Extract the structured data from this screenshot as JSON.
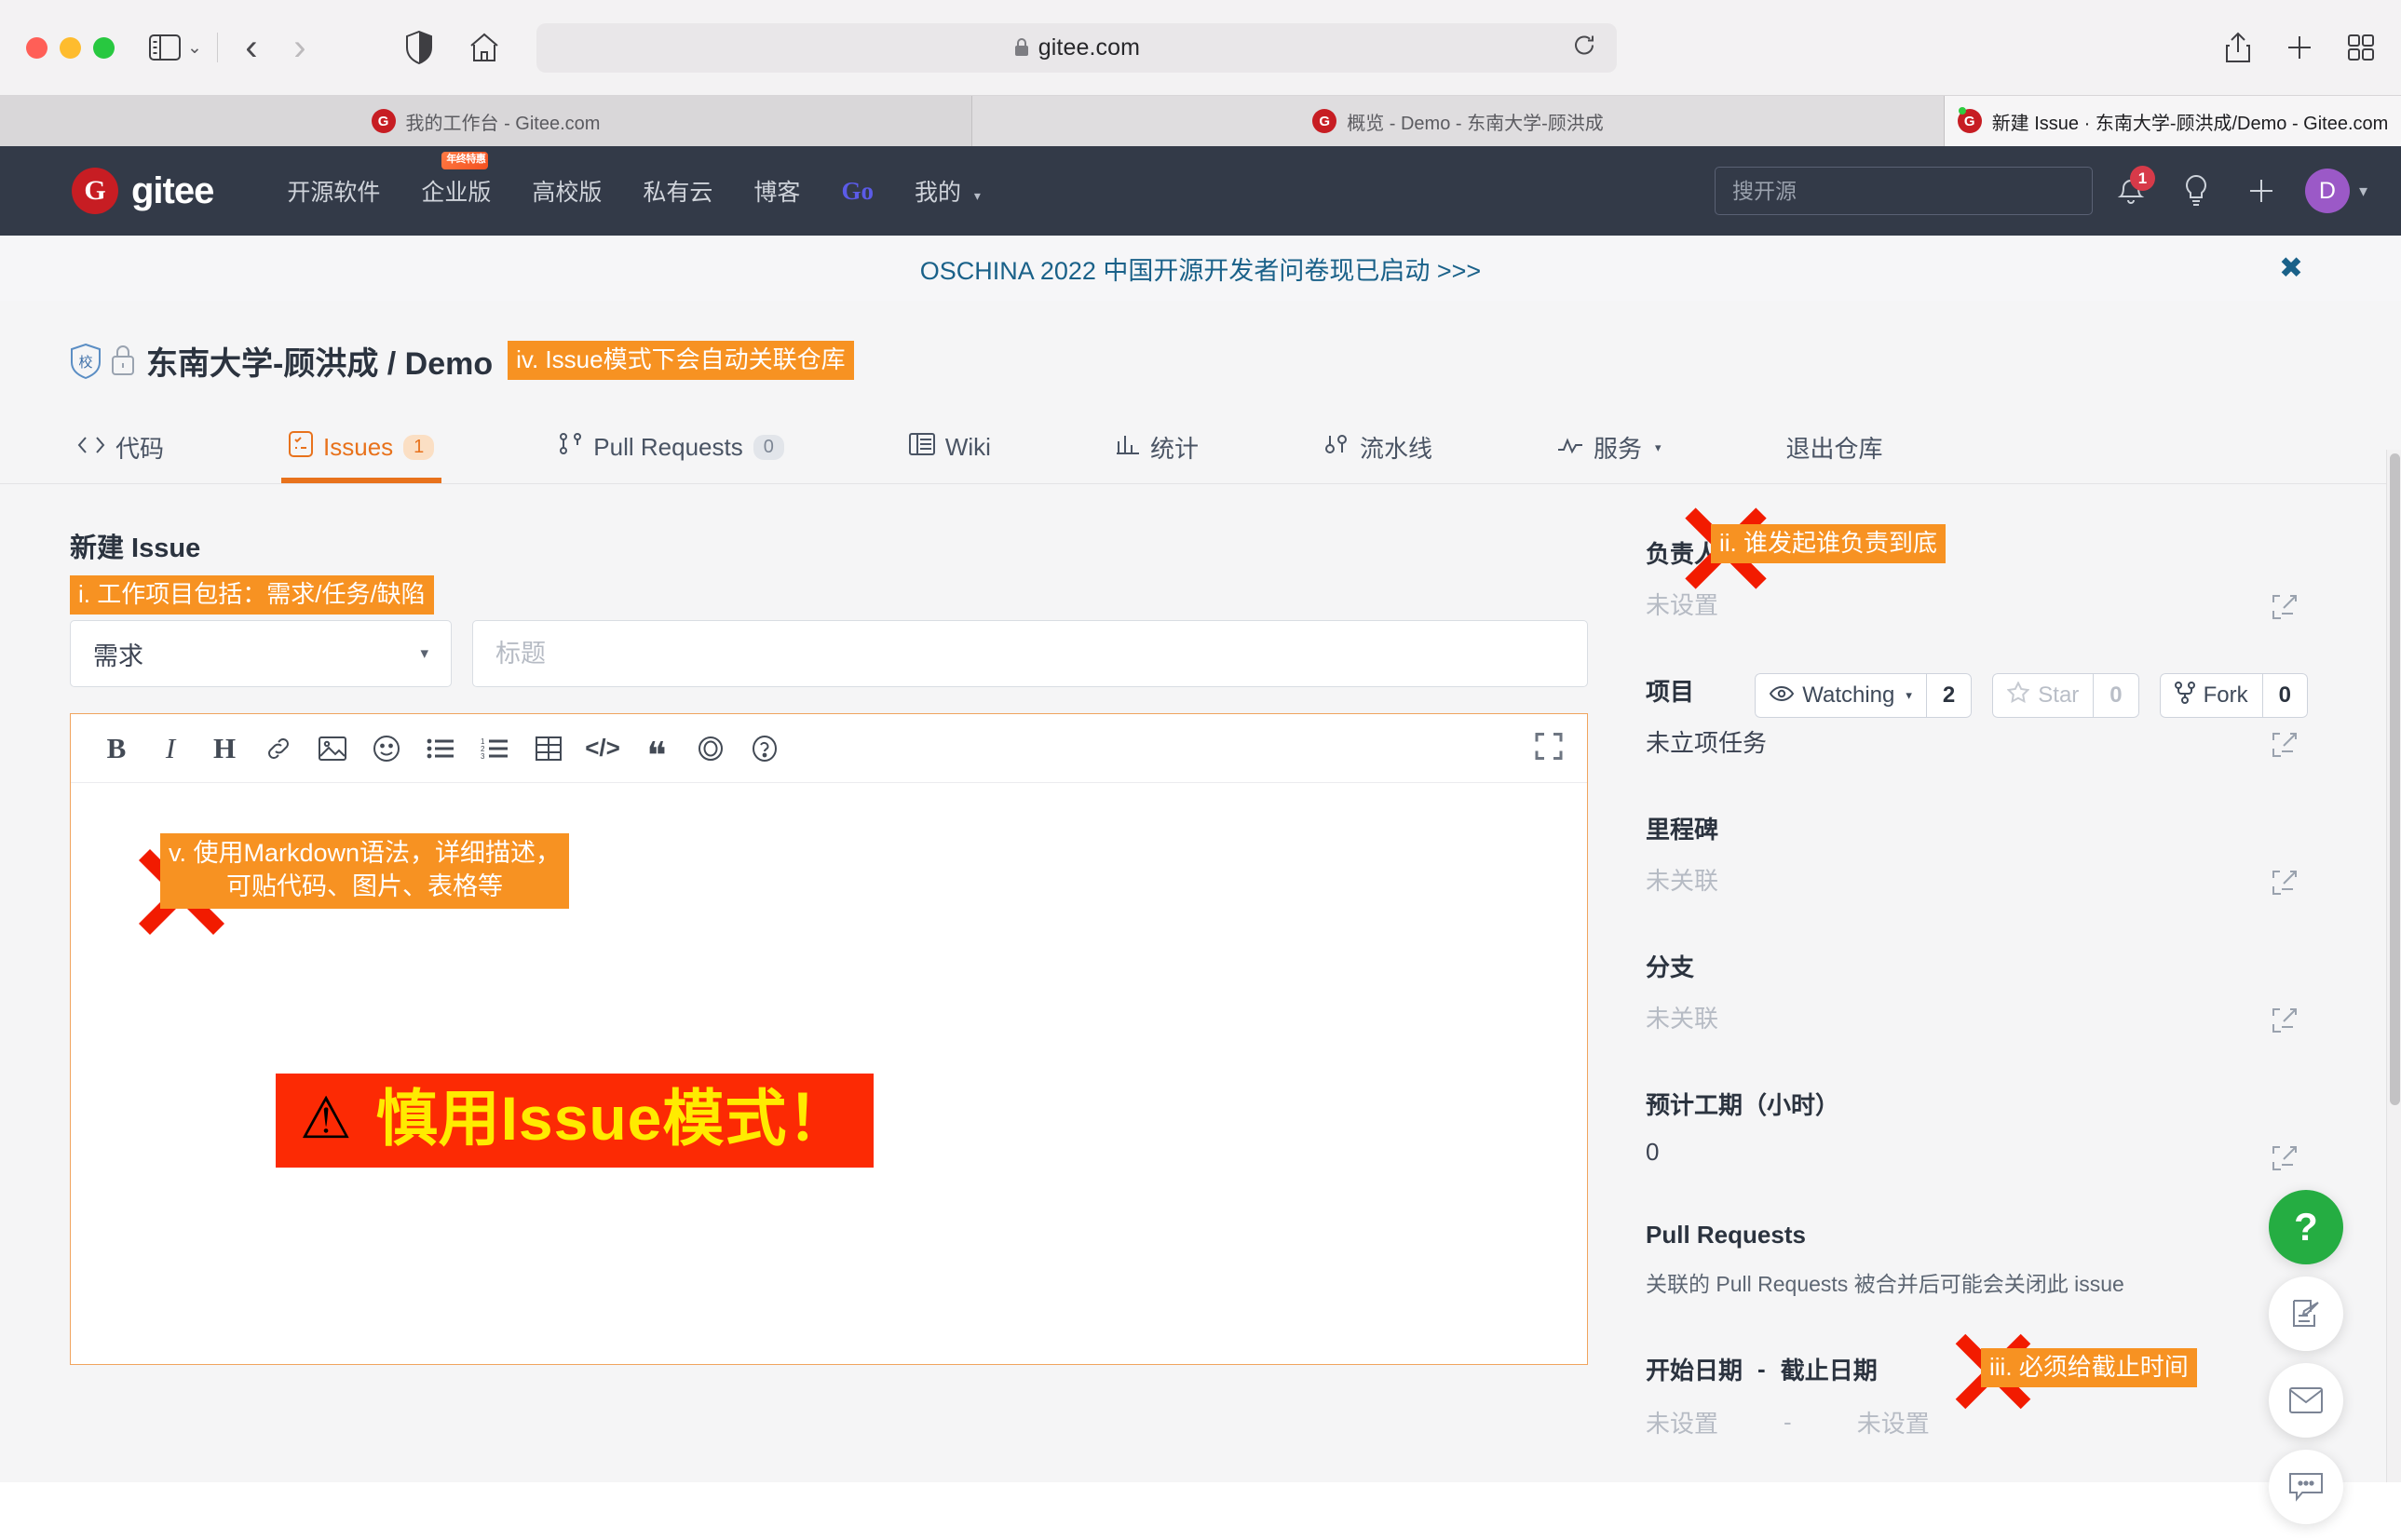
{
  "browser": {
    "url": "gitee.com",
    "tabs": [
      {
        "title": "我的工作台 - Gitee.com",
        "active": false
      },
      {
        "title": "概览 - Demo - 东南大学-顾洪成",
        "active": false
      },
      {
        "title": "新建 Issue · 东南大学-顾洪成/Demo - Gitee.com",
        "active": true
      }
    ]
  },
  "gitee_nav": {
    "logo_text": "gitee",
    "logo_mark": "G",
    "items": [
      {
        "label": "开源软件"
      },
      {
        "label": "企业版",
        "badge": "年终特惠"
      },
      {
        "label": "高校版"
      },
      {
        "label": "私有云"
      },
      {
        "label": "博客"
      },
      {
        "label": "Go"
      },
      {
        "label": "我的",
        "caret": true
      }
    ],
    "search_placeholder": "搜开源",
    "notification_count": "1",
    "avatar_letter": "D"
  },
  "promo": {
    "text": "OSCHINA 2022 中国开源开发者问卷现已启动 >>>",
    "close": "✖"
  },
  "repo": {
    "owner_slash_name": "东南大学-顾洪成 / Demo",
    "school_badge": "校",
    "annotation_iv": "iv. Issue模式下会自动关联仓库",
    "actions": [
      {
        "label": "Watching",
        "count": "2",
        "icon": "eye-icon",
        "muted": false,
        "caret": true
      },
      {
        "label": "Star",
        "count": "0",
        "icon": "star-icon",
        "muted": true,
        "caret": false
      },
      {
        "label": "Fork",
        "count": "0",
        "icon": "fork-icon",
        "muted": false,
        "caret": false
      }
    ],
    "tabs": [
      {
        "label": "代码",
        "icon": "code-icon",
        "count": null,
        "active": false
      },
      {
        "label": "Issues",
        "icon": "issue-icon",
        "count": "1",
        "active": true
      },
      {
        "label": "Pull Requests",
        "icon": "pr-icon",
        "count": "0",
        "active": false
      },
      {
        "label": "Wiki",
        "icon": "wiki-icon",
        "count": null,
        "active": false
      },
      {
        "label": "统计",
        "icon": "stats-icon",
        "count": null,
        "active": false
      },
      {
        "label": "流水线",
        "icon": "pipeline-icon",
        "count": null,
        "active": false
      },
      {
        "label": "服务",
        "icon": "service-icon",
        "count": null,
        "active": false,
        "caret": true
      },
      {
        "label": "退出仓库",
        "icon": null,
        "count": null,
        "active": false
      }
    ]
  },
  "form": {
    "page_title": "新建 Issue",
    "annotation_i": "i. 工作项目包括：需求/任务/缺陷",
    "type_value": "需求",
    "title_placeholder": "标题",
    "toolbar": [
      {
        "name": "bold-icon",
        "glyph": "B"
      },
      {
        "name": "italic-icon",
        "glyph": "I"
      },
      {
        "name": "heading-icon",
        "glyph": "H"
      },
      {
        "name": "link-icon",
        "glyph": "🔗"
      },
      {
        "name": "image-icon",
        "glyph": "🖼"
      },
      {
        "name": "emoji-icon",
        "glyph": "☺"
      },
      {
        "name": "bullet-list-icon",
        "glyph": "☰"
      },
      {
        "name": "numbered-list-icon",
        "glyph": "≡"
      },
      {
        "name": "table-icon",
        "glyph": "▦"
      },
      {
        "name": "code-icon",
        "glyph": "</>"
      },
      {
        "name": "quote-icon",
        "glyph": "❝"
      },
      {
        "name": "preview-icon",
        "glyph": "◉"
      },
      {
        "name": "help-icon",
        "glyph": "?"
      }
    ],
    "fullscreen_icon": "fullscreen-icon",
    "annotation_v": "v. 使用Markdown语法，详细描述，\n可贴代码、图片、表格等",
    "warning_icon": "⚠",
    "warning_text": "慎用Issue模式！"
  },
  "sidebar": {
    "fields": [
      {
        "label": "负责人",
        "value": "未设置",
        "muted": true,
        "edit": true,
        "annotation": "ii. 谁发起谁负责到底"
      },
      {
        "label": "项目",
        "value": "未立项任务",
        "muted": false,
        "edit": true
      },
      {
        "label": "里程碑",
        "value": "未关联",
        "muted": true,
        "edit": true
      },
      {
        "label": "分支",
        "value": "未关联",
        "muted": true,
        "edit": true
      },
      {
        "label": "预计工期（小时）",
        "value": "0",
        "muted": false,
        "edit": true
      }
    ],
    "pull_requests": {
      "label": "Pull Requests",
      "note": "关联的 Pull Requests 被合并后可能会关闭此 issue"
    },
    "dates": {
      "start_label": "开始日期",
      "dash": "-",
      "end_label": "截止日期",
      "start_value": "未设置",
      "end_value": "未设置",
      "annotation": "iii. 必须给截止时间"
    }
  },
  "fabs": [
    {
      "name": "help-fab",
      "glyph": "?"
    },
    {
      "name": "feedback-fab",
      "glyph": "edit"
    },
    {
      "name": "mail-fab",
      "glyph": "mail"
    },
    {
      "name": "chat-fab",
      "glyph": "chat"
    }
  ],
  "colors": {
    "accent_orange": "#e8721c",
    "annotation_orange": "#f79222",
    "nav_dark": "#333a48",
    "warning_red": "#fc2a04",
    "warning_yellow": "#ffeb00",
    "green": "#25ad42"
  }
}
